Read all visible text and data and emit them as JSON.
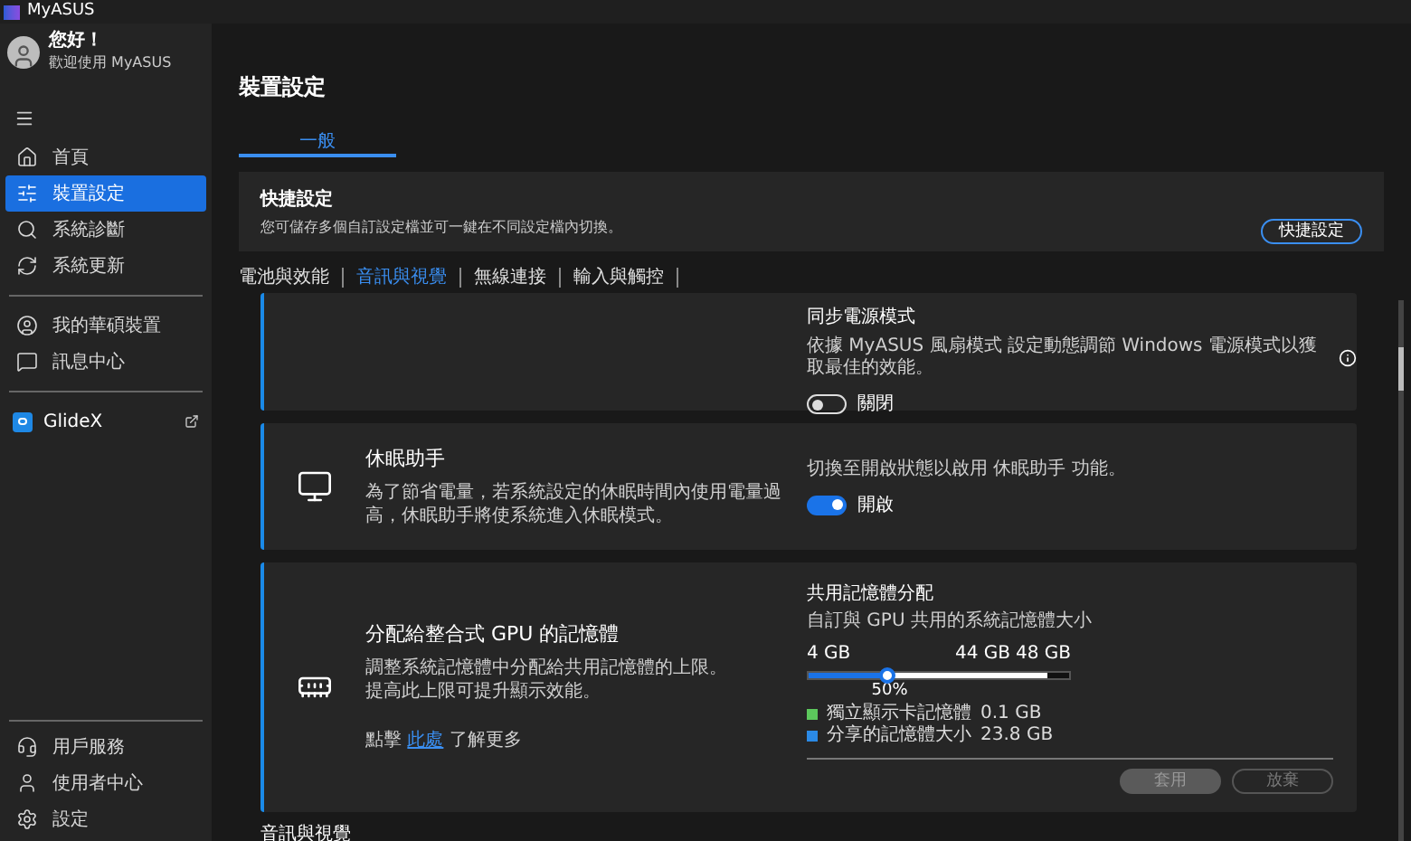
{
  "app": {
    "title": "MyASUS"
  },
  "user": {
    "greeting": "您好！",
    "subtitle": "歡迎使用 MyASUS"
  },
  "sidebar": {
    "nav": [
      {
        "label": "首頁",
        "selected": false
      },
      {
        "label": "裝置設定",
        "selected": true
      },
      {
        "label": "系統診斷",
        "selected": false
      },
      {
        "label": "系統更新",
        "selected": false
      }
    ],
    "devices": [
      {
        "label": "我的華碩裝置",
        "selected": false
      },
      {
        "label": "訊息中心",
        "selected": false
      }
    ],
    "apps": [
      {
        "label": "GlideX"
      }
    ],
    "footer": [
      {
        "label": "用戶服務",
        "selected": false
      },
      {
        "label": "使用者中心",
        "selected": false
      },
      {
        "label": "設定",
        "selected": false
      }
    ]
  },
  "page": {
    "title": "裝置設定",
    "tabs": [
      {
        "label": "一般",
        "selected": true
      }
    ],
    "quick": {
      "title": "快捷設定",
      "description": "您可儲存多個自訂設定檔並可一鍵在不同設定檔內切換。",
      "button": "快捷設定"
    },
    "subtabs": [
      {
        "label": "電池與效能",
        "selected": false
      },
      {
        "label": "音訊與視覺",
        "selected": true
      },
      {
        "label": "無線連接",
        "selected": false
      },
      {
        "label": "輸入與觸控",
        "selected": false
      }
    ],
    "cards": [
      {
        "kind": "toggle",
        "setting_title": "同步電源模式",
        "setting_description": "依據 MyASUS 風扇模式 設定動態調節 Windows 電源模式以獲取最佳的效能。",
        "on": false,
        "state_label": "關閉"
      },
      {
        "kind": "toggle",
        "title": "休眠助手",
        "description": "為了節省電量，若系統設定的休眠時間內使用電量過高，休眠助手將使系統進入休眠模式。",
        "setting_description": "切換至開啟狀態以啟用 休眠助手 功能。",
        "on": true,
        "state_label": "開啟"
      },
      {
        "kind": "memory",
        "title": "分配給整合式 GPU 的記憶體",
        "description": [
          "調整系統記憶體中分配給共用記憶體的上限。",
          "提高此上限可提升顯示效能。"
        ],
        "learn_more": {
          "before": "點擊",
          "link": "此處",
          "after": "了解更多"
        },
        "setting_title": "共用記憶體分配",
        "setting_description": "自訂與 GPU 共用的系統記憶體大小",
        "slider": {
          "min_label": "4 GB",
          "marks": [
            "44 GB",
            "48 GB"
          ],
          "level": 0.3,
          "reading": "50%"
        },
        "legend": [
          {
            "label": "獨立顯示卡記憶體",
            "value": "0.1 GB",
            "color": "#5cc85c"
          },
          {
            "label": "分享的記憶體大小",
            "value": "23.8 GB",
            "color": "#2b8ae6"
          }
        ],
        "buttons": [
          {
            "label": "套用",
            "kind": "filled",
            "disabled": true
          },
          {
            "label": "放棄",
            "kind": "outline",
            "disabled": true
          }
        ]
      }
    ],
    "section_heading": "音訊與視覺"
  }
}
